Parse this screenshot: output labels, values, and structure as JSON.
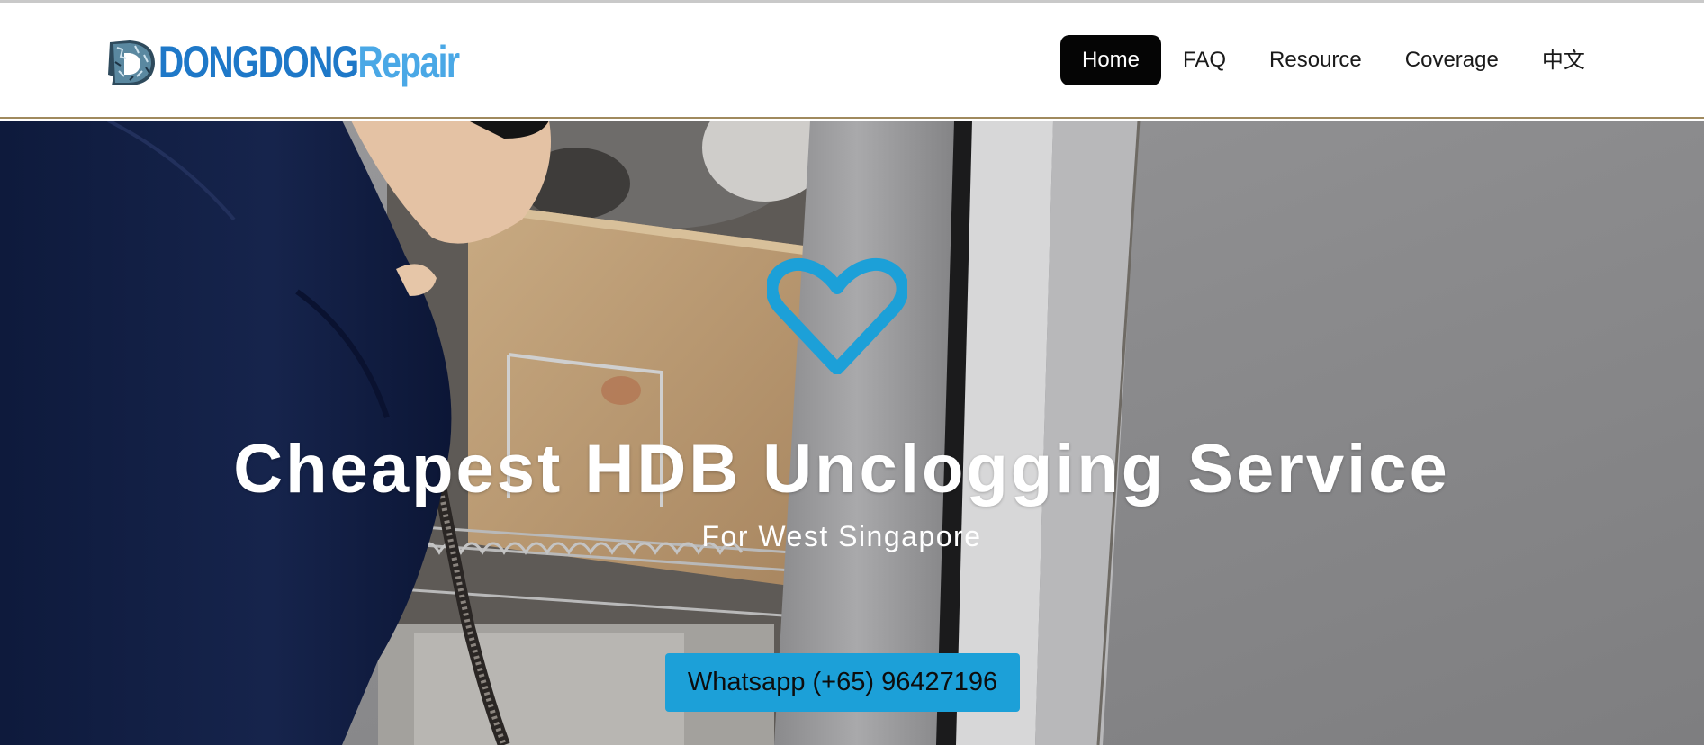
{
  "header": {
    "logo": {
      "text_part1": "DONGDONG",
      "text_part2": "Repair",
      "icon": "d-letter-logo-icon"
    },
    "nav": [
      {
        "label": "Home",
        "active": true
      },
      {
        "label": "FAQ",
        "active": false
      },
      {
        "label": "Resource",
        "active": false
      },
      {
        "label": "Coverage",
        "active": false
      },
      {
        "label": "中文",
        "active": false
      }
    ]
  },
  "hero": {
    "icon": "heart-outline-icon",
    "title": "Cheapest HDB Unclogging Service",
    "subtitle": "For West Singapore",
    "cta_label": "Whatsapp (+65) 96427196"
  },
  "colors": {
    "accent": "#1ca0d8",
    "logo_dark_blue": "#1e78c8",
    "logo_light_blue": "#4aa8e6",
    "nav_active_bg": "#050505"
  }
}
